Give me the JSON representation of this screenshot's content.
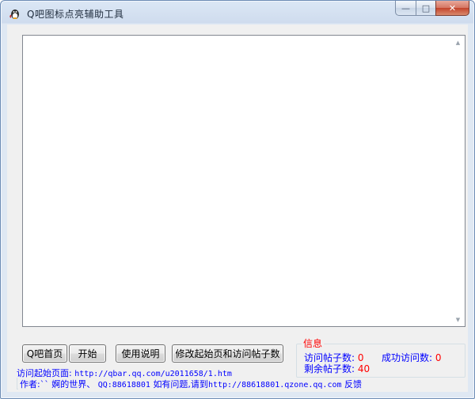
{
  "window": {
    "title": "Q吧图标点亮辅助工具",
    "minimize_glyph": "—",
    "maximize_glyph": "□",
    "close_glyph": "✕"
  },
  "main_textarea": {
    "value": ""
  },
  "buttons": {
    "home": "Q吧首页",
    "start": "开始",
    "help": "使用说明",
    "modify": "修改起始页和访问帖子数"
  },
  "info": {
    "title": "信息",
    "visit_label": "访问帖子数:",
    "visit_value": "0",
    "success_label": "成功访问数:",
    "success_value": "0",
    "remain_label": "剩余帖子数:",
    "remain_value": "40"
  },
  "start_page": {
    "label": "访问起始页面:",
    "url": "http://qbar.qq.com/u2011658/1.htm"
  },
  "author": {
    "prefix": "作者:`` 婀的世界、",
    "qq": "QQ:88618801",
    "question_prefix": "如有问题,请到",
    "link": "http://88618801.qzone.qq.com",
    "suffix": "反馈"
  },
  "colors": {
    "info_text": "#0000ff",
    "info_value": "#ff0000",
    "frame": "#dfe8f3"
  },
  "icons": [
    "app-icon",
    "minimize-icon",
    "maximize-icon",
    "close-icon",
    "scroll-up-icon",
    "scroll-down-icon"
  ]
}
